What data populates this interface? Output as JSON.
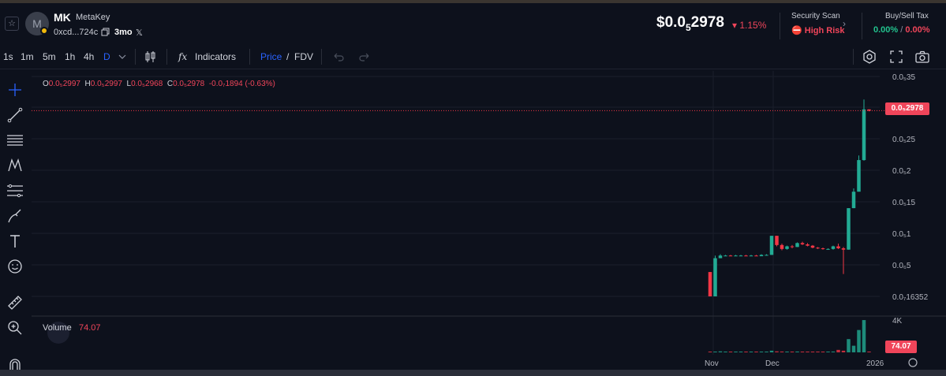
{
  "header": {
    "star_icon": "star-icon",
    "avatar_letter": "M",
    "symbol": "MK",
    "name": "MetaKey",
    "address": "0xcd...724c",
    "age": "3mo",
    "price_main": "$0.0",
    "price_sub": "5",
    "price_rest": "2978",
    "price_change": "1.15%",
    "security_title": "Security Scan",
    "security_risk": "High Risk",
    "tax_title": "Buy/Sell Tax",
    "tax_buy": "0.00%",
    "tax_sep": " / ",
    "tax_sell": "0.00%"
  },
  "toolbar": {
    "timeframes": [
      "1s",
      "1m",
      "5m",
      "1h",
      "4h",
      "D"
    ],
    "active_timeframe": "D",
    "indicators_label": "Indicators",
    "price_label": "Price",
    "slash": "/",
    "fdv_label": "FDV"
  },
  "chart": {
    "ohlc": {
      "o_label": "O",
      "o_value": "0.0₅2997",
      "h_label": "H",
      "h_value": "0.0₅2997",
      "l_label": "L",
      "l_value": "0.0₅2968",
      "c_label": "C",
      "c_value": "0.0₅2978",
      "change": "-0.0₇1894 (-0.63%)"
    },
    "volume_label": "Volume",
    "volume_value": "74.07",
    "current_price_tag": "0.0₅2978",
    "volume_tag": "74.07",
    "colors": {
      "up": "#22ab94",
      "down": "#f23645",
      "grid": "#1a1e2b",
      "text": "#b2b5be"
    }
  },
  "chart_data": {
    "type": "candlestick",
    "y_axis_ticks": [
      "0.0₅35",
      "0.0₅25",
      "0.0₅2",
      "0.0₅15",
      "0.0₅1",
      "0.0₆5",
      "0.0₇16352"
    ],
    "volume_axis_ticks": [
      "4K"
    ],
    "x_axis_ticks": [
      "Nov",
      "Dec",
      "2026"
    ],
    "ylim": [
      1e-07,
      3.5e-06
    ],
    "candles": [
      {
        "o": 5.3e-07,
        "h": 5.3e-07,
        "l": 1.6e-07,
        "c": 1.6e-07
      },
      {
        "o": 1.6e-07,
        "h": 7.8e-07,
        "l": 1.6e-07,
        "c": 7.4e-07
      },
      {
        "o": 7.4e-07,
        "h": 8e-07,
        "l": 7.4e-07,
        "c": 7.8e-07
      },
      {
        "o": 7.8e-07,
        "h": 7.9e-07,
        "l": 7.7e-07,
        "c": 7.8e-07
      },
      {
        "o": 7.8e-07,
        "h": 7.9e-07,
        "l": 7.7e-07,
        "c": 7.7e-07
      },
      {
        "o": 7.7e-07,
        "h": 7.9e-07,
        "l": 7.7e-07,
        "c": 7.8e-07
      },
      {
        "o": 7.8e-07,
        "h": 7.9e-07,
        "l": 7.7e-07,
        "c": 7.8e-07
      },
      {
        "o": 7.8e-07,
        "h": 7.9e-07,
        "l": 7.7e-07,
        "c": 7.7e-07
      },
      {
        "o": 7.7e-07,
        "h": 7.9e-07,
        "l": 7.7e-07,
        "c": 7.8e-07
      },
      {
        "o": 7.8e-07,
        "h": 7.9e-07,
        "l": 7.7e-07,
        "c": 7.7e-07
      },
      {
        "o": 7.7e-07,
        "h": 8e-07,
        "l": 7.7e-07,
        "c": 7.9e-07
      },
      {
        "o": 7.9e-07,
        "h": 8e-07,
        "l": 7.8e-07,
        "c": 7.9e-07
      },
      {
        "o": 7.9e-07,
        "h": 1.08e-06,
        "l": 7.9e-07,
        "c": 1.08e-06
      },
      {
        "o": 1.08e-06,
        "h": 1.08e-06,
        "l": 9.2e-07,
        "c": 9.4e-07
      },
      {
        "o": 9.4e-07,
        "h": 9.6e-07,
        "l": 8.6e-07,
        "c": 8.8e-07
      },
      {
        "o": 8.8e-07,
        "h": 9.3e-07,
        "l": 8.7e-07,
        "c": 9.2e-07
      },
      {
        "o": 9.2e-07,
        "h": 9.4e-07,
        "l": 8.9e-07,
        "c": 9.1e-07
      },
      {
        "o": 9.1e-07,
        "h": 9.8e-07,
        "l": 9.1e-07,
        "c": 9.7e-07
      },
      {
        "o": 9.7e-07,
        "h": 9.9e-07,
        "l": 9.4e-07,
        "c": 9.5e-07
      },
      {
        "o": 9.5e-07,
        "h": 9.7e-07,
        "l": 9.2e-07,
        "c": 9.3e-07
      },
      {
        "o": 9.3e-07,
        "h": 9.4e-07,
        "l": 8.9e-07,
        "c": 9e-07
      },
      {
        "o": 9e-07,
        "h": 9.1e-07,
        "l": 8.8e-07,
        "c": 8.9e-07
      },
      {
        "o": 8.9e-07,
        "h": 9e-07,
        "l": 8.7e-07,
        "c": 8.8e-07
      },
      {
        "o": 8.8e-07,
        "h": 8.9e-07,
        "l": 8.7e-07,
        "c": 8.8e-07
      },
      {
        "o": 8.8e-07,
        "h": 9.3e-07,
        "l": 8.7e-07,
        "c": 9.2e-07
      },
      {
        "o": 9.2e-07,
        "h": 9.6e-07,
        "l": 8.8e-07,
        "c": 8.9e-07
      },
      {
        "o": 8.9e-07,
        "h": 9.1e-07,
        "l": 5e-07,
        "c": 8.7e-07
      },
      {
        "o": 8.7e-07,
        "h": 1.5e-06,
        "l": 8.7e-07,
        "c": 1.5e-06
      },
      {
        "o": 1.5e-06,
        "h": 1.8e-06,
        "l": 1.5e-06,
        "c": 1.75e-06
      },
      {
        "o": 1.75e-06,
        "h": 2.3e-06,
        "l": 1.75e-06,
        "c": 2.23e-06
      },
      {
        "o": 2.23e-06,
        "h": 3.15e-06,
        "l": 2.22e-06,
        "c": 3e-06
      },
      {
        "o": 3e-06,
        "h": 3e-06,
        "l": 2.97e-06,
        "c": 2.98e-06
      }
    ],
    "volume": [
      0,
      80,
      120,
      40,
      30,
      60,
      40,
      30,
      60,
      30,
      40,
      60,
      200,
      120,
      100,
      80,
      90,
      100,
      90,
      80,
      60,
      90,
      60,
      40,
      100,
      300,
      200,
      1600,
      800,
      2700,
      3900,
      74
    ]
  },
  "left_tools": [
    "crosshair-icon",
    "trend-line-icon",
    "horizontal-lines-icon",
    "pattern-icon",
    "fib-icon",
    "brush-icon",
    "text-icon",
    "emoji-icon",
    "ruler-icon",
    "zoom-icon",
    "magnet-icon"
  ]
}
